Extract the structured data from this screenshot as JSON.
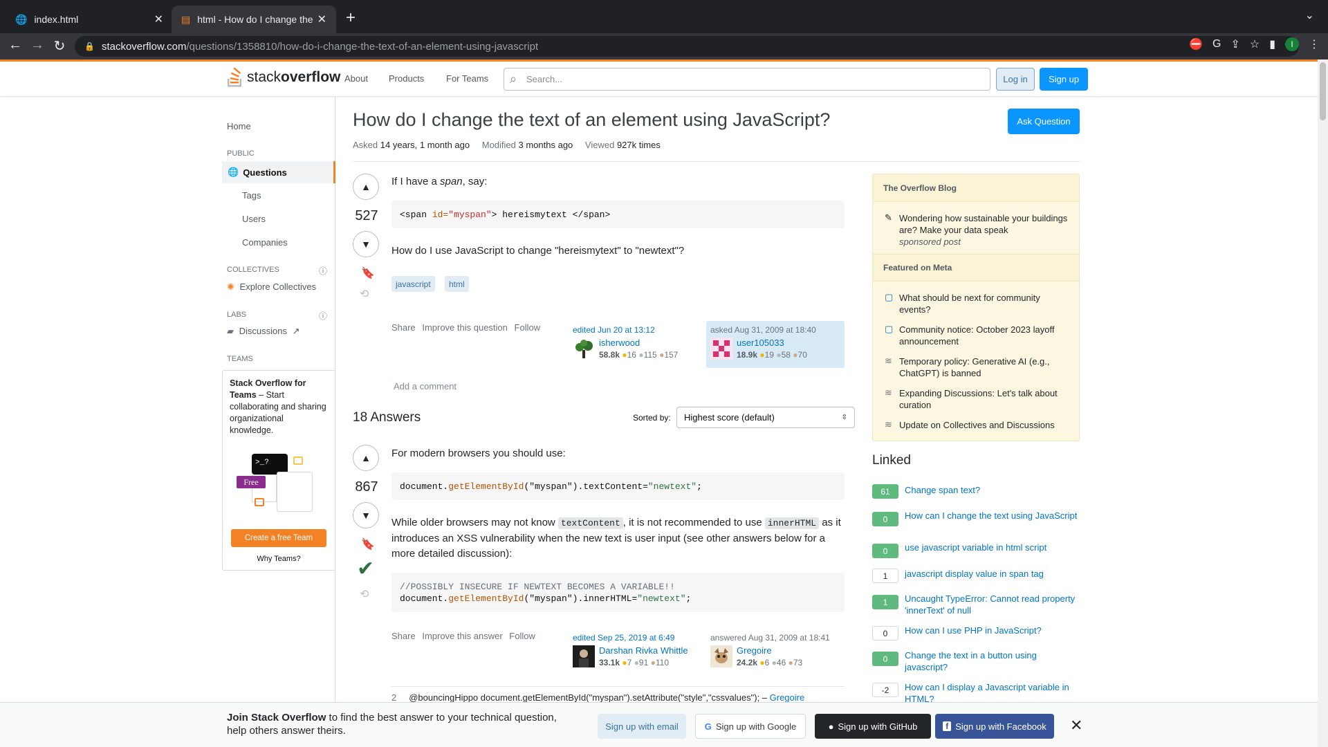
{
  "browser": {
    "tabs": [
      {
        "title": "index.html",
        "active": false
      },
      {
        "title": "html - How do I change the tex",
        "active": true
      }
    ],
    "url_host": "stackoverflow.com",
    "url_path": "/questions/1358810/how-do-i-change-the-text-of-an-element-using-javascript",
    "profile_initial": "I"
  },
  "header": {
    "logo_light": "stack",
    "logo_bold": "overflow",
    "nav": [
      "About",
      "Products",
      "For Teams"
    ],
    "search_placeholder": "Search...",
    "login": "Log in",
    "signup": "Sign up"
  },
  "sidebar": {
    "home": "Home",
    "public_caption": "PUBLIC",
    "questions": "Questions",
    "tags": "Tags",
    "users": "Users",
    "companies": "Companies",
    "collectives_caption": "COLLECTIVES",
    "explore_collectives": "Explore Collectives",
    "labs_caption": "LABS",
    "discussions": "Discussions",
    "teams_caption": "TEAMS",
    "teams_title": "Stack Overflow for Teams",
    "teams_desc": " – Start collaborating and sharing organizational knowledge.",
    "teams_free": "Free",
    "teams_cli": ">_?",
    "create_team": "Create a free Team",
    "why_teams": "Why Teams?"
  },
  "question": {
    "title": "How do I change the text of an element using JavaScript?",
    "asked_label": "Asked",
    "asked_value": "14 years, 1 month ago",
    "modified_label": "Modified",
    "modified_value": "3 months ago",
    "viewed_label": "Viewed",
    "viewed_value": "927k times",
    "ask_button": "Ask Question",
    "score": "527",
    "intro": "If I have a ",
    "intro_em": "span",
    "intro_end": ", say:",
    "code_open": "<span ",
    "code_attr": "id=",
    "code_val": "\"myspan\"",
    "code_rest": "> hereismytext </span>",
    "body": "How do I use JavaScript to change \"hereismytext\" to \"newtext\"?",
    "tags": [
      "javascript",
      "html"
    ],
    "menu": [
      "Share",
      "Improve this question",
      "Follow"
    ],
    "editor": {
      "action": "edited Jun 20 at 13:12",
      "name": "isherwood",
      "rep": "58.8k",
      "gold": "16",
      "silver": "115",
      "bronze": "157"
    },
    "owner": {
      "action": "asked Aug 31, 2009 at 18:40",
      "name": "user105033",
      "rep": "18.9k",
      "gold": "19",
      "silver": "58",
      "bronze": "70"
    },
    "add_comment": "Add a comment"
  },
  "answers": {
    "heading": "18 Answers",
    "sorted_label": "Sorted by:",
    "sort_value": "Highest score (default)",
    "first": {
      "score": "867",
      "intro": "For modern browsers you should use:",
      "code1_obj": "document.",
      "code1_fn": "getElementById",
      "code1_arg": "(\"myspan\")",
      "code1_end": ".textContent=",
      "code1_str": "\"newtext\"",
      "code1_semi": ";",
      "p2_a": "While older browsers may not know ",
      "p2_code1": "textContent",
      "p2_b": ", it is not recommended to use ",
      "p2_code2": "innerHTML",
      "p2_c": " as it introduces an XSS vulnerability when the new text is user input (see other answers below for a more detailed discussion):",
      "code2_comment": "//POSSIBLY INSECURE IF NEWTEXT BECOMES A VARIABLE!!",
      "code2_obj": "document.",
      "code2_fn": "getElementById",
      "code2_arg": "(\"myspan\")",
      "code2_end": ".innerHTML=",
      "code2_str": "\"newtext\"",
      "code2_semi": ";",
      "menu": [
        "Share",
        "Improve this answer",
        "Follow"
      ],
      "editor": {
        "action": "edited Sep 25, 2019 at 6:49",
        "name": "Darshan Rivka Whittle",
        "rep": "33.1k",
        "gold": "7",
        "silver": "91",
        "bronze": "110"
      },
      "owner": {
        "action": "answered Aug 31, 2009 at 18:41",
        "name": "Gregoire",
        "rep": "24.2k",
        "gold": "6",
        "silver": "46",
        "bronze": "73"
      },
      "comment": {
        "score": "2",
        "text": "@bouncingHippo document.getElementById(\"myspan\").setAttribute(\"style\",\"cssvalues\"); – ",
        "author": "Gregoire"
      }
    }
  },
  "blog": {
    "heading": "The Overflow Blog",
    "post": "Wondering how sustainable your buildings are? Make your data speak",
    "post_note": "sponsored post",
    "meta_heading": "Featured on Meta",
    "meta_items": [
      "What should be next for community events?",
      "Community notice: October 2023 layoff announcement",
      "Temporary policy: Generative AI (e.g., ChatGPT) is banned",
      "Expanding Discussions: Let's talk about curation",
      "Update on Collectives and Discussions"
    ]
  },
  "linked": {
    "heading": "Linked",
    "items": [
      {
        "score": "61",
        "text": "Change span text?"
      },
      {
        "score": "0",
        "text": "How can I change the text using JavaScript"
      },
      {
        "score": "0",
        "text": "use javascript variable in html script"
      },
      {
        "score": "1",
        "text": "javascript display value in span tag"
      },
      {
        "score": "1",
        "text": "Uncaught TypeError: Cannot read property 'innerText' of null"
      },
      {
        "score": "0",
        "text": "How can I use PHP in JavaScript?"
      },
      {
        "score": "0",
        "text": "Change the text in a button using javascript?"
      },
      {
        "score": "-2",
        "text": "How can I display a Javascript variable in HTML?"
      }
    ]
  },
  "banner": {
    "bold": "Join Stack Overflow",
    "text": " to find the best answer to your technical question, help others answer theirs.",
    "email": "Sign up with email",
    "google": "Sign up with Google",
    "github": "Sign up with GitHub",
    "facebook": "Sign up with Facebook"
  },
  "colors": {
    "accent": "#f48225",
    "primary": "#0a95ff",
    "link": "#0074cc",
    "accepted": "#2f6f44"
  }
}
